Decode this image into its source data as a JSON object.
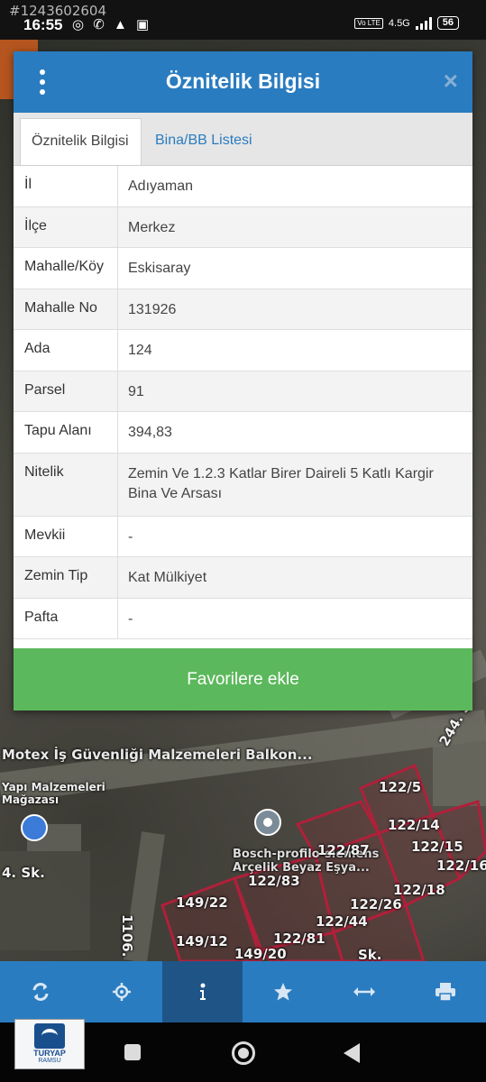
{
  "status_bar": {
    "watermark": "#1243602604",
    "time": "16:55",
    "network": "4.5G",
    "volte": "Vo LTE",
    "battery": "56"
  },
  "dialog": {
    "title": "Öznitelik Bilgisi",
    "close_symbol": "×",
    "tabs": [
      {
        "label": "Öznitelik Bilgisi",
        "active": true
      },
      {
        "label": "Bina/BB Listesi",
        "active": false
      }
    ],
    "rows": [
      {
        "label": "İl",
        "value": "Adıyaman"
      },
      {
        "label": "İlçe",
        "value": "Merkez"
      },
      {
        "label": "Mahalle/Köy",
        "value": "Eskisaray"
      },
      {
        "label": "Mahalle No",
        "value": "131926"
      },
      {
        "label": "Ada",
        "value": "124"
      },
      {
        "label": "Parsel",
        "value": "91"
      },
      {
        "label": "Tapu Alanı",
        "value": "394,83"
      },
      {
        "label": "Nitelik",
        "value": "Zemin Ve 1.2.3 Katlar Birer Daireli 5 Katlı Kargir Bina Ve Arsası"
      },
      {
        "label": "Mevkii",
        "value": "-"
      },
      {
        "label": "Zemin Tip",
        "value": "Kat Mülkiyet"
      },
      {
        "label": "Pafta",
        "value": "-"
      }
    ],
    "favorite_button": "Favorilere ekle"
  },
  "map": {
    "poi": "Motex İş Güvenliği Malzemeleri Balkon...",
    "poi2": "Yapı Malzemeleri Mağazası",
    "business": "Bosch-profilo-siemens Arçelik Beyaz Eşya...",
    "streets": [
      "4. Sk.",
      "1106. Sk.",
      "244. S",
      "Sk."
    ],
    "parcels": [
      "122/5",
      "122/14",
      "122/15",
      "122/16",
      "122/87",
      "122/83",
      "122/18",
      "122/26",
      "122/44",
      "149/22",
      "149/12",
      "122/81",
      "149/20"
    ]
  },
  "toolbar": {
    "icons": [
      "refresh-icon",
      "locate-icon",
      "info-icon",
      "star-icon",
      "measure-icon",
      "print-icon"
    ],
    "active": "info-icon"
  },
  "logo": {
    "name": "TURYAP",
    "sub": "RAMSU"
  },
  "colors": {
    "header": "#2a7cc0",
    "button": "#5cb85c",
    "parcel_outline": "#b0203a"
  }
}
